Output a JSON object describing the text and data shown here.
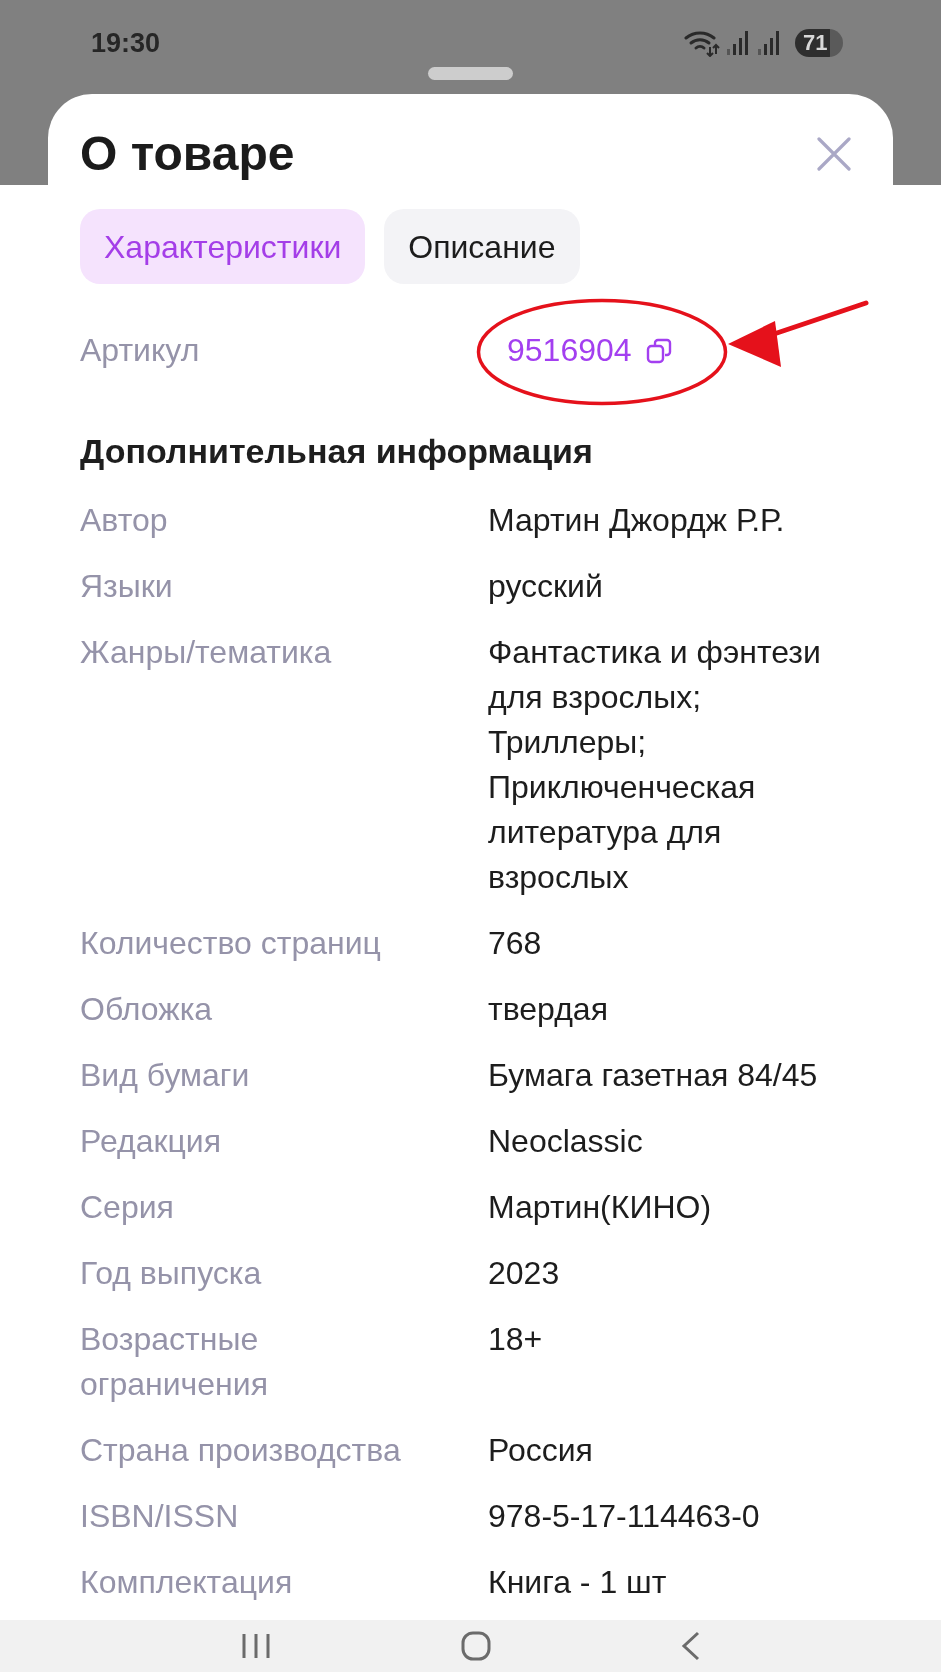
{
  "status_bar": {
    "time": "19:30",
    "battery": "71"
  },
  "sheet": {
    "title": "О товаре"
  },
  "tabs": [
    {
      "label": "Характеристики",
      "selected": true
    },
    {
      "label": "Описание",
      "selected": false
    }
  ],
  "article": {
    "label": "Артикул",
    "value": "9516904"
  },
  "details": {
    "title": "Дополнительная информация",
    "rows": [
      {
        "label": "Автор",
        "value": "Мартин Джордж Р.Р."
      },
      {
        "label": "Языки",
        "value": "русский"
      },
      {
        "label": "Жанры/тематика",
        "value": "Фантастика и фэнтези для взрослых; Триллеры; Приключенческая литература для взрослых"
      },
      {
        "label": "Количество страниц",
        "value": "768"
      },
      {
        "label": "Обложка",
        "value": "твердая"
      },
      {
        "label": "Вид бумаги",
        "value": "Бумага газетная 84/45"
      },
      {
        "label": "Редакция",
        "value": "Neoclassic"
      },
      {
        "label": "Серия",
        "value": "Мартин(КИНО)"
      },
      {
        "label": "Год выпуска",
        "value": "2023"
      },
      {
        "label": "Возрастные ограничения",
        "value": "18+"
      },
      {
        "label": "Страна производства",
        "value": "Россия"
      },
      {
        "label": "ISBN/ISSN",
        "value": "978-5-17-114463-0"
      },
      {
        "label": "Комплектация",
        "value": "Книга - 1 шт"
      }
    ]
  }
}
